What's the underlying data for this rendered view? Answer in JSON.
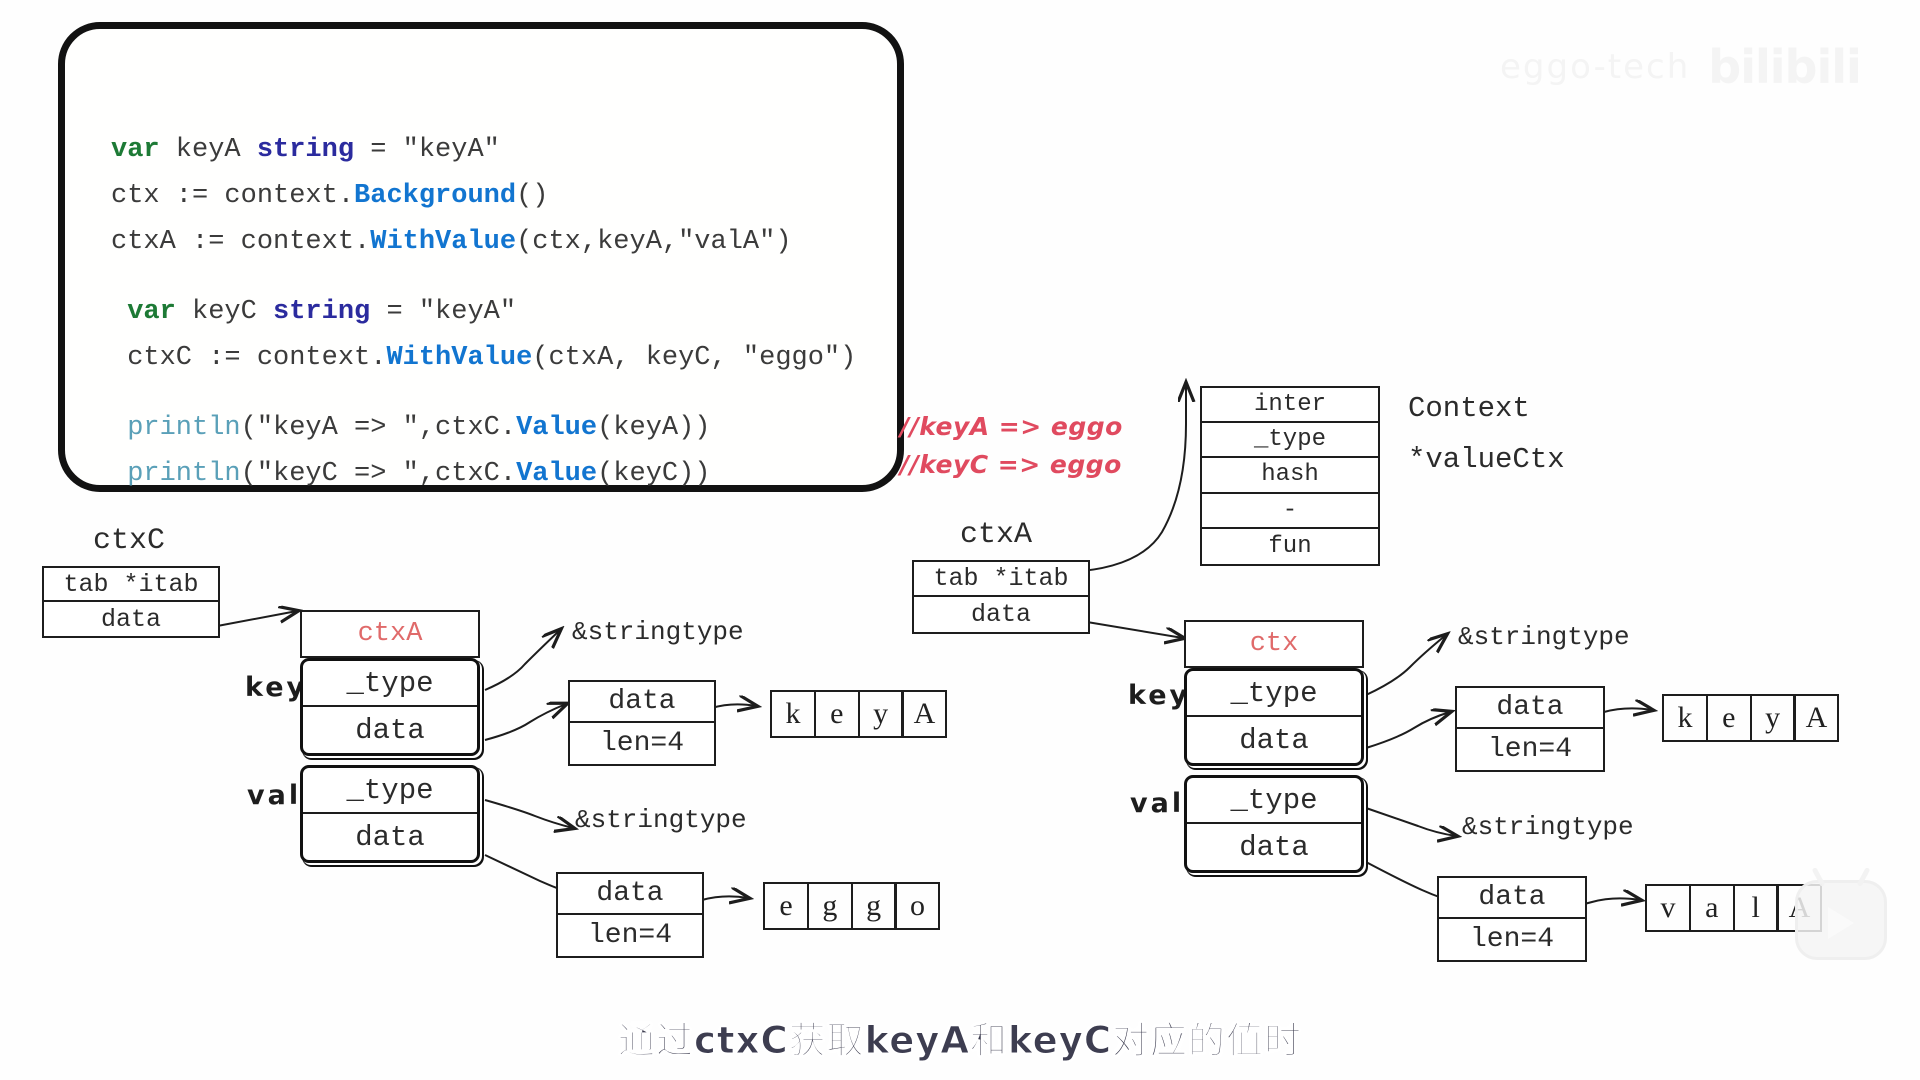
{
  "watermark": {
    "text": "eggo-tech",
    "logo": "bilibili"
  },
  "code": {
    "lines": [
      [
        {
          "t": "var",
          "c": "kw"
        },
        {
          "t": " keyA ",
          "c": "pl"
        },
        {
          "t": "string",
          "c": "typ"
        },
        {
          "t": " = \"keyA\"",
          "c": "pl"
        }
      ],
      [
        {
          "t": "ctx := context.",
          "c": "pl"
        },
        {
          "t": "Background",
          "c": "fn"
        },
        {
          "t": "()",
          "c": "pl"
        }
      ],
      [
        {
          "t": "ctxA := context.",
          "c": "pl"
        },
        {
          "t": "WithValue",
          "c": "fn"
        },
        {
          "t": "(ctx,keyA,\"valA\")",
          "c": "pl"
        }
      ],
      [
        {
          "t": "",
          "c": "spacer"
        }
      ],
      [
        {
          "t": " var",
          "c": "kw"
        },
        {
          "t": " keyC ",
          "c": "pl"
        },
        {
          "t": "string",
          "c": "typ"
        },
        {
          "t": " = \"keyA\"",
          "c": "pl"
        }
      ],
      [
        {
          "t": " ctxC := context.",
          "c": "pl"
        },
        {
          "t": "WithValue",
          "c": "fn"
        },
        {
          "t": "(ctxA, keyC, \"eggo\")",
          "c": "pl"
        }
      ],
      [
        {
          "t": "",
          "c": "spacer"
        }
      ],
      [
        {
          "t": " println",
          "c": "fnq"
        },
        {
          "t": "(\"keyA => \",ctxC.",
          "c": "pl"
        },
        {
          "t": "Value",
          "c": "fn"
        },
        {
          "t": "(keyA))",
          "c": "pl"
        }
      ],
      [
        {
          "t": " println",
          "c": "fnq"
        },
        {
          "t": "(\"keyC => \",ctxC.",
          "c": "pl"
        },
        {
          "t": "Value",
          "c": "fn"
        },
        {
          "t": "(keyC))",
          "c": "pl"
        }
      ]
    ]
  },
  "comments": {
    "line1": "//keyA => eggo",
    "line2": "//keyC => eggo",
    "color": "#e04a5f"
  },
  "itab": {
    "rows": [
      "inter",
      "_type",
      "hash",
      "-",
      "fun"
    ],
    "caption_line1": "Context",
    "caption_line2": "*valueCtx"
  },
  "left_diagram": {
    "iface_title": "ctxC",
    "iface_rows": [
      "tab *itab",
      "data"
    ],
    "struct_title": "ctxA",
    "struct_title_color": "#e06a6a",
    "key_label": "key",
    "val_label": "val",
    "key_pair": [
      "_type",
      "data"
    ],
    "val_pair": [
      "_type",
      "data"
    ],
    "key_type_target": "&stringtype",
    "val_type_target": "&stringtype",
    "key_string": {
      "rows": [
        "data",
        "len=4"
      ],
      "chars": [
        "k",
        "e",
        "y",
        "A"
      ]
    },
    "val_string": {
      "rows": [
        "data",
        "len=4"
      ],
      "chars": [
        "e",
        "g",
        "g",
        "o"
      ]
    }
  },
  "right_diagram": {
    "iface_title": "ctxA",
    "iface_rows": [
      "tab *itab",
      "data"
    ],
    "struct_title": "ctx",
    "struct_title_color": "#e06a6a",
    "key_label": "key",
    "val_label": "val",
    "key_pair": [
      "_type",
      "data"
    ],
    "val_pair": [
      "_type",
      "data"
    ],
    "key_type_target": "&stringtype",
    "val_type_target": "&stringtype",
    "key_string": {
      "rows": [
        "data",
        "len=4"
      ],
      "chars": [
        "k",
        "e",
        "y",
        "A"
      ]
    },
    "val_string": {
      "rows": [
        "data",
        "len=4"
      ],
      "chars": [
        "v",
        "a",
        "l",
        "A"
      ]
    }
  },
  "subtitle": "通过ctxC获取keyA和keyC对应的值时"
}
